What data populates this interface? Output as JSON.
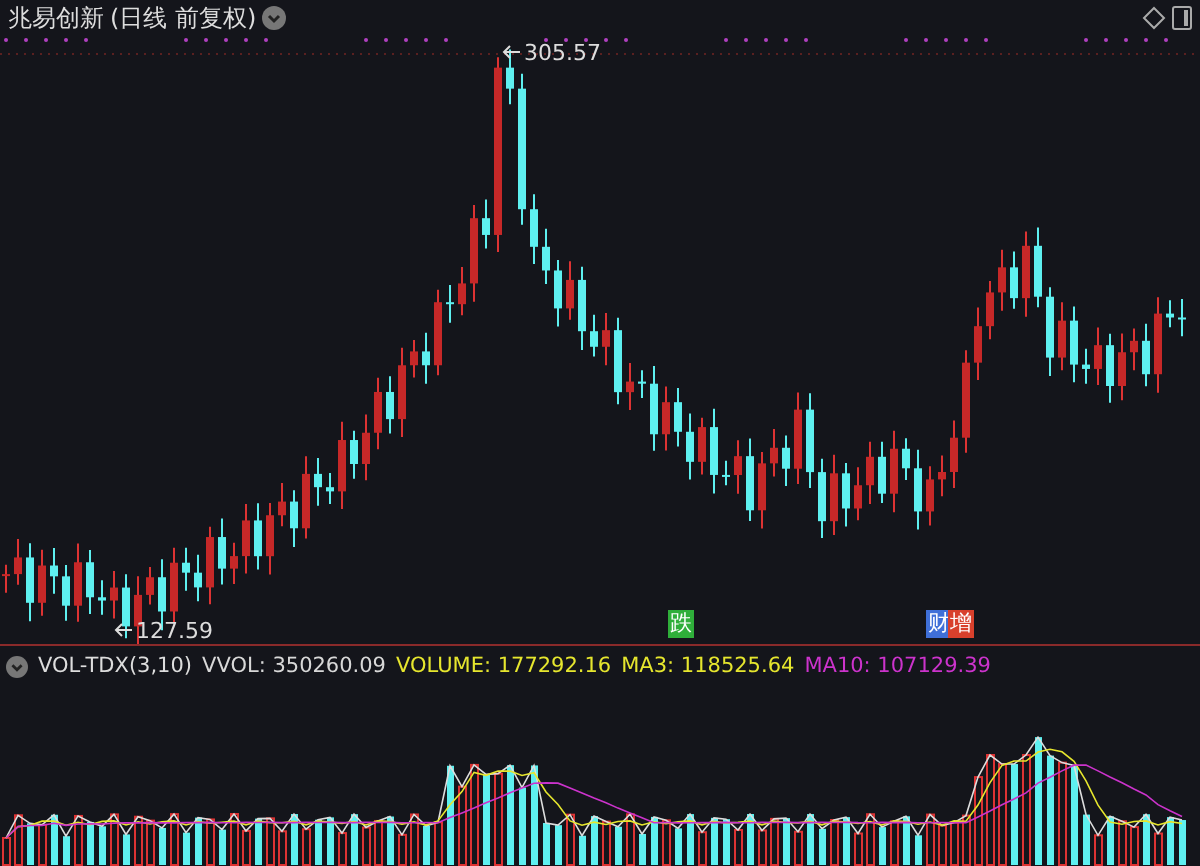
{
  "title": "兆易创新",
  "period": "(日线 前复权)",
  "chart": {
    "high_label": "305.57",
    "low_label": "127.59",
    "markers": [
      {
        "text": "跌",
        "color": "#2fae3a"
      },
      {
        "text": "财",
        "color": "#3f6fd8"
      },
      {
        "text": "增",
        "color": "#d8402c"
      }
    ]
  },
  "indicator": {
    "name": "VOL-TDX(3,10)",
    "values": [
      {
        "label": "VVOL: 350260.09",
        "color": "#d8d8d8"
      },
      {
        "label": "VOLUME: 177292.16",
        "color": "#e6e62e"
      },
      {
        "label": "MA3: 118525.64",
        "color": "#e6e62e"
      },
      {
        "label": "MA10: 107129.39",
        "color": "#cc33cc"
      }
    ]
  }
}
